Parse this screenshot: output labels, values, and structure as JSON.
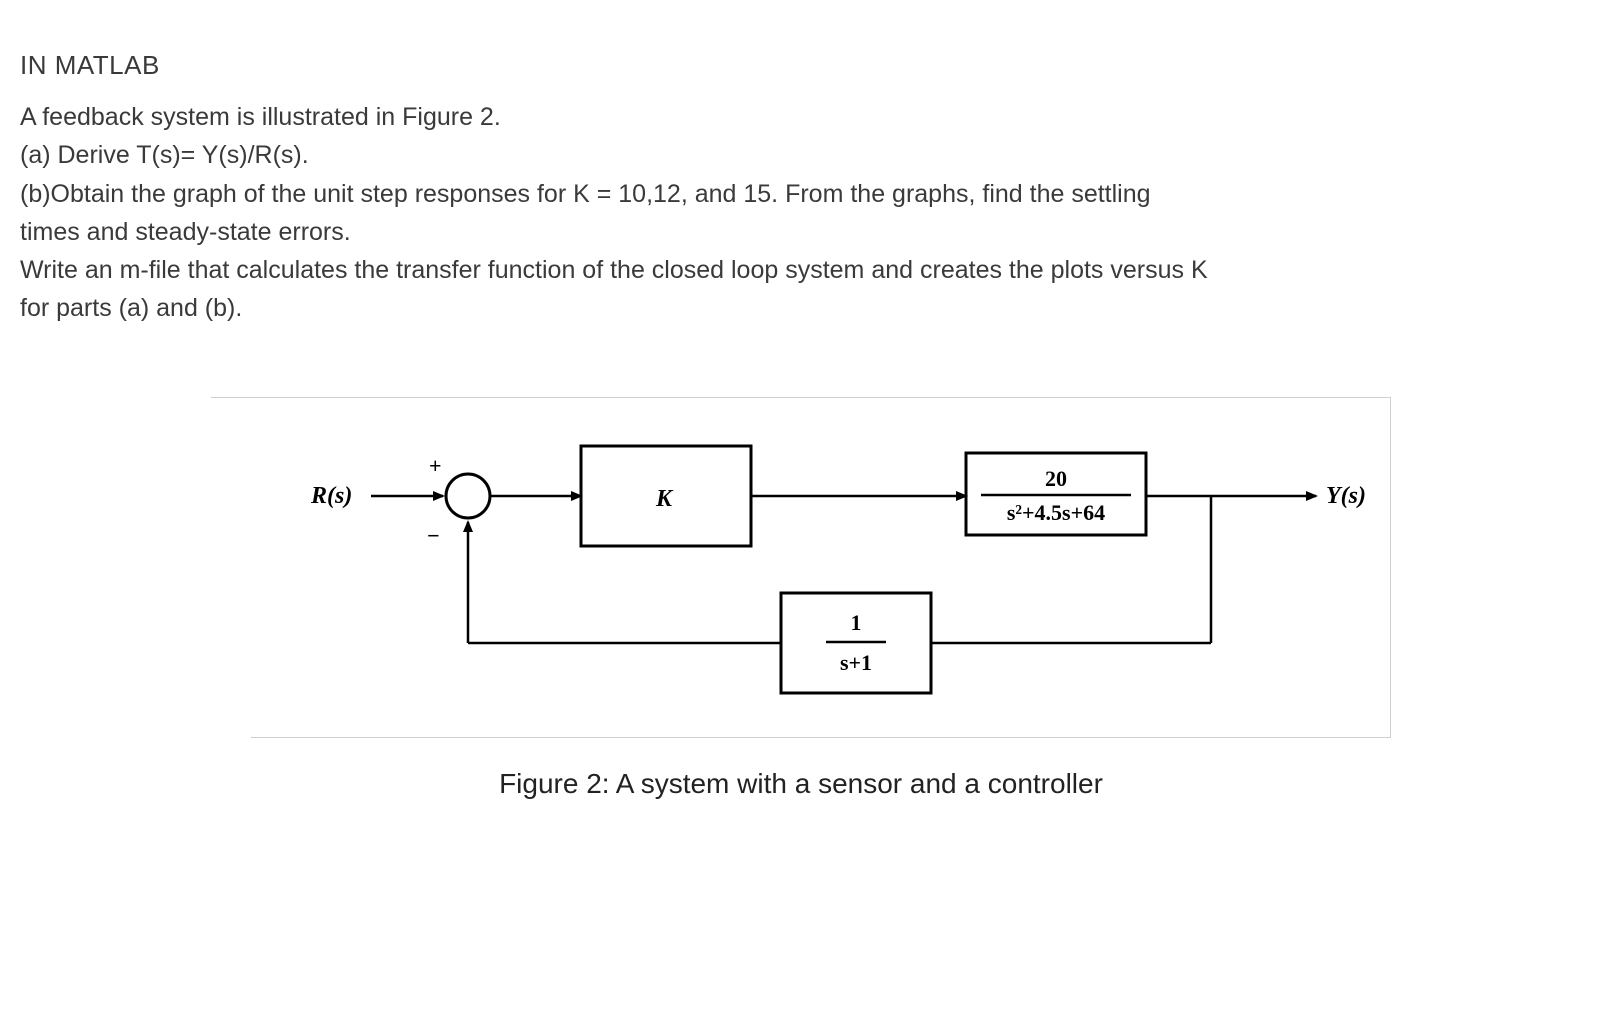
{
  "heading": "IN MATLAB",
  "lines": {
    "l1": "A feedback system is illustrated in Figure 2.",
    "l2": "(a) Derive T(s)= Y(s)/R(s).",
    "l3": "(b)Obtain the graph of the unit step responses for K = 10,12, and 15. From the graphs, find the settling",
    "l4": "times and steady-state errors.",
    "l5": "Write an m-file that calculates the transfer function of the closed loop system and creates the plots versus K",
    "l6": "for parts (a) and (b)."
  },
  "diagram": {
    "input_label": "R(s)",
    "output_label": "Y(s)",
    "sum_plus": "+",
    "sum_minus": "−",
    "block_controller": "K",
    "block_plant_num": "20",
    "block_plant_den": "s²+4.5s+64",
    "block_sensor_num": "1",
    "block_sensor_den": "s+1"
  },
  "caption": "Figure 2: A system with a sensor and a controller"
}
